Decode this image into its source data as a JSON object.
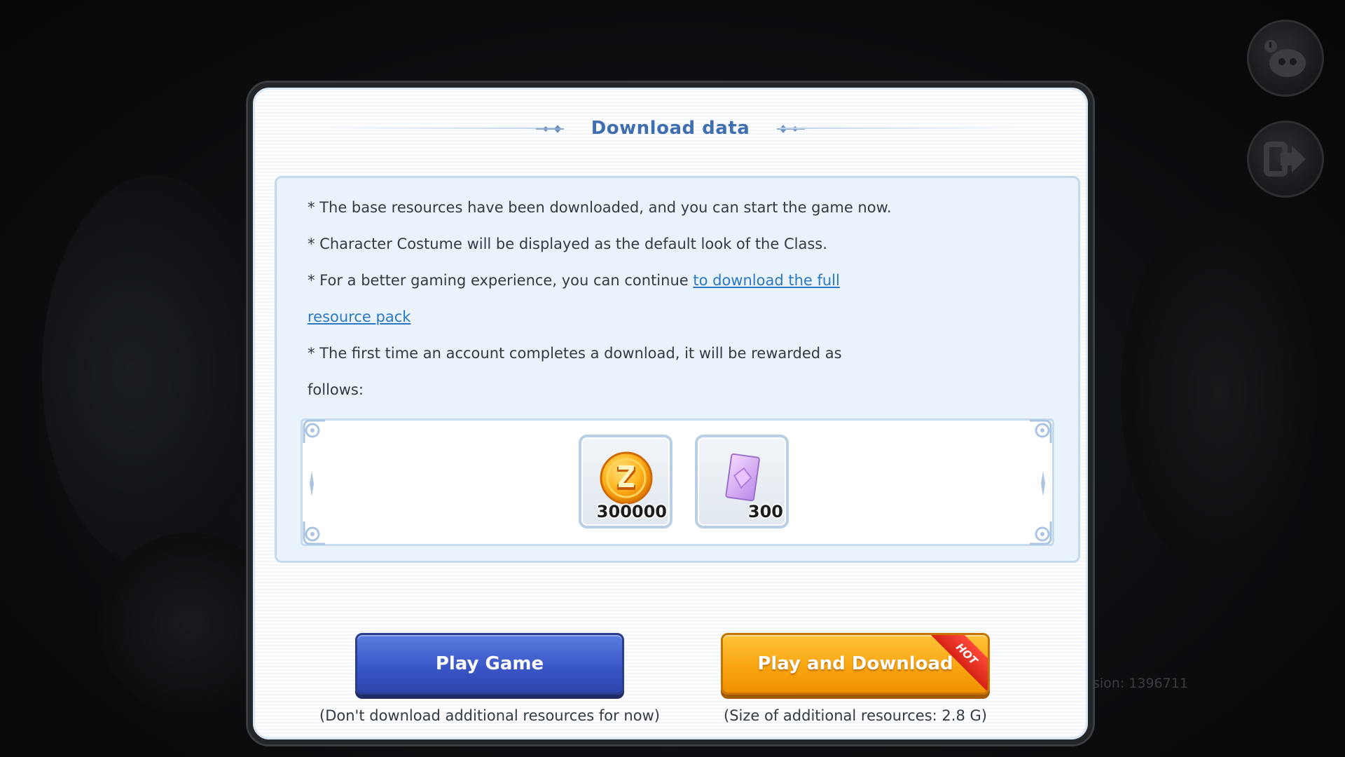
{
  "dialog": {
    "title": "Download data",
    "info": {
      "line1": "* The base resources have been downloaded, and you can start the game now.",
      "line2": "* Character Costume will be displayed as the default look of the Class.",
      "line3_prefix": "* For a better gaming experience, you can continue ",
      "line3_link": "to download the full",
      "line4_link": "resource pack",
      "line5": "* The first time an account completes a download, it will be rewarded as",
      "line6": "follows:"
    },
    "rewards": [
      {
        "icon": "zeny-coin-icon",
        "count": "300000"
      },
      {
        "icon": "purple-card-icon",
        "count": "300"
      }
    ],
    "buttons": {
      "play_game": "Play Game",
      "play_game_note": "(Don't download additional resources for now)",
      "play_download": "Play and Download",
      "play_download_badge": "HOT",
      "play_download_note": "(Size of additional resources: 2.8 G)"
    }
  },
  "side_buttons": [
    {
      "icon": "poring-pet-icon"
    },
    {
      "icon": "exit-icon"
    }
  ],
  "version_text": "sion: 1396711",
  "colors": {
    "title": "#3f6fb0",
    "link": "#2b78c2",
    "play_button": "#3a57c8",
    "download_button": "#f9a512",
    "hot_badge": "#e8301f"
  }
}
